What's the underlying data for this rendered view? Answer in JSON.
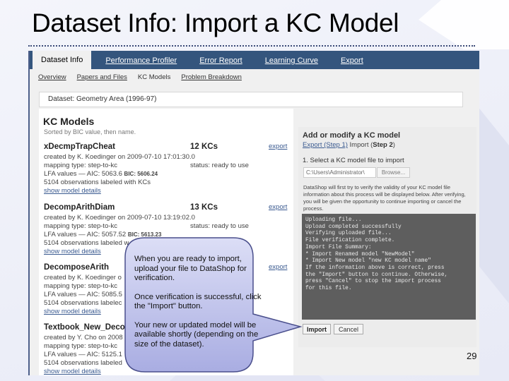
{
  "slide": {
    "title": "Dataset Info: Import a KC Model",
    "page_number": "29"
  },
  "nav": {
    "tabs": [
      {
        "label": "Dataset Info",
        "active": true
      },
      {
        "label": "Performance Profiler",
        "active": false
      },
      {
        "label": "Error Report",
        "active": false
      },
      {
        "label": "Learning Curve",
        "active": false
      },
      {
        "label": "Export",
        "active": false
      }
    ],
    "subtabs": [
      {
        "label": "Overview",
        "current": false
      },
      {
        "label": "Papers and Files",
        "current": false
      },
      {
        "label": "KC Models",
        "current": true
      },
      {
        "label": "Problem Breakdown",
        "current": false
      }
    ]
  },
  "dataset": {
    "label": "Dataset: Geometry Area (1996-97)"
  },
  "kc_models": {
    "heading": "KC Models",
    "subheading": "Sorted by BIC value, then name.",
    "models": [
      {
        "name": "xDecmpTrapCheat",
        "kcs": "12 KCs",
        "export_label": "export",
        "created": "created by K. Koedinger on 2009-07-10 17:01:30.0",
        "mapping": "mapping type: step-to-kc",
        "status": "status: ready to use",
        "lfa": "LFA values — AIC: 5063.6",
        "bic": "BIC: 5606.24",
        "observations": "5104 observations labeled with KCs",
        "details_label": "show model details"
      },
      {
        "name": "DecompArithDiam",
        "kcs": "13 KCs",
        "export_label": "export",
        "created": "created by K. Koedinger on 2009-07-10 13:19:02.0",
        "mapping": "mapping type: step-to-kc",
        "status": "status: ready to use",
        "lfa": "LFA values — AIC: 5057.52",
        "bic": "BIC: 5613.23",
        "observations": "5104 observations labeled w",
        "details_label": "show model details"
      },
      {
        "name": "DecomposeArith",
        "kcs": "",
        "export_label": "export",
        "created": "created by K. Koedinger o",
        "mapping": "mapping type: step-to-kc",
        "status": "",
        "lfa": "LFA values — AIC: 5085.5",
        "bic": "",
        "observations": "5104 observations labelec",
        "details_label": "show model details"
      },
      {
        "name": "Textbook_New_Deco",
        "kcs": "",
        "export_label": "",
        "created": "created by Y. Cho on 2008",
        "mapping": "mapping type: step-to-kc",
        "status": "",
        "lfa": "LFA values — AIC: 5125.1",
        "bic": "",
        "observations": "5104 observations labeled",
        "details_label": "show model details"
      }
    ]
  },
  "import_panel": {
    "title": "Add or modify a KC model",
    "step1_link": "Export (Step 1)",
    "step2_prefix": "Import (",
    "step2_bold": "Step 2",
    "step2_suffix": ")",
    "select_label": "1. Select a KC model file to import",
    "file_value": "C:\\Users\\Administrator\\",
    "browse_label": "Browse...",
    "info_text": "DataShop will first try to verify the validity of your KC model file information about this process will be displayed below. After verifying, you will be given the opportunity to continue importing or cancel the process.",
    "console_lines": [
      "Uploading file...",
      "Upload completed successfully",
      "Verifying uploaded file...",
      "File verification complete.",
      "Import File Summary:",
      "* Import Renamed model \"NewModel\"",
      "* Import New model \"new KC model name\"",
      "If the information above is correct, press",
      "the \"Import\" button to continue. Otherwise,",
      "press \"Cancel\" to stop the import process",
      "for this file."
    ],
    "import_label": "Import",
    "cancel_label": "Cancel"
  },
  "callout": {
    "paragraphs": [
      "When you are ready to import, upload your file to DataShop for verification.",
      "Once verification is successful, click the \"Import\" button.",
      "Your new or updated model will be available shortly (depending on the size of the dataset)."
    ],
    "fill_color": "#b4b8e8",
    "border_color": "#4a4f8c"
  }
}
